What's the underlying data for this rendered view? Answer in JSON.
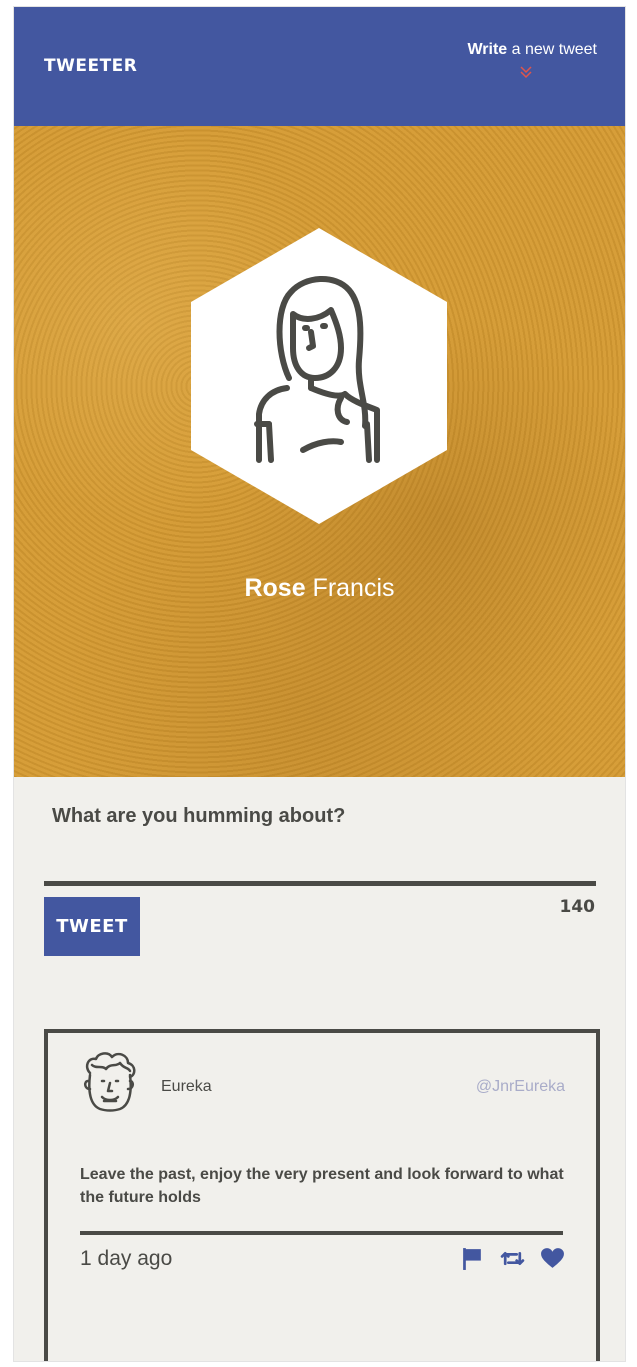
{
  "nav": {
    "brand": "TWEETER",
    "compose_link_strong": "Write",
    "compose_link_rest": " a new tweet",
    "compose_link_icon": "chevron-double-down-icon"
  },
  "profile": {
    "avatar_icon": "woman-avatar-icon",
    "first_name": "Rose",
    "last_name": " Francis"
  },
  "composer": {
    "label": "What are you humming about?",
    "input_value": "",
    "button_label": "TWEET",
    "char_count": "140"
  },
  "tweets": [
    {
      "avatar_icon": "curly-haired-man-avatar-icon",
      "name": "Eureka",
      "handle": "@JnrEureka",
      "text": "Leave the past, enjoy the very present and look forward to what the future holds",
      "time": "1 day ago",
      "actions": [
        "flag-icon",
        "retweet-icon",
        "heart-icon"
      ]
    }
  ],
  "colors": {
    "brand_blue": "#4357a0",
    "hero_gold": "#d59a31",
    "page_bg": "#f1f0ec",
    "text_dark": "#4a4a46",
    "handle_muted": "#a9acc9",
    "chevron_red": "#e0554a"
  }
}
